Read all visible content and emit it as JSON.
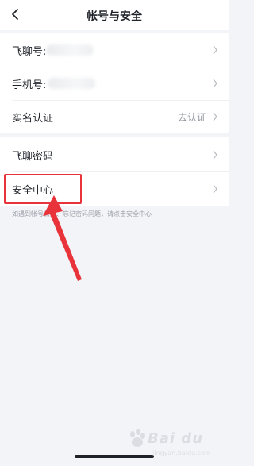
{
  "header": {
    "title": "帐号与安全"
  },
  "account_group": [
    {
      "label": "飞聊号:",
      "value_masked": true
    },
    {
      "label": "手机号:",
      "value_masked": true
    },
    {
      "label": "实名认证",
      "value": "去认证"
    }
  ],
  "security_group": [
    {
      "label": "飞聊密码"
    },
    {
      "label": "安全中心"
    }
  ],
  "hint": "如遇到帐号丢失、忘记密码问题，请点击安全中心",
  "annotation": {
    "highlight_color": "#e8333b",
    "highlighted_item": "安全中心"
  },
  "watermark": {
    "brand": "Bai du",
    "sub": "jingyan.baidu.com"
  }
}
